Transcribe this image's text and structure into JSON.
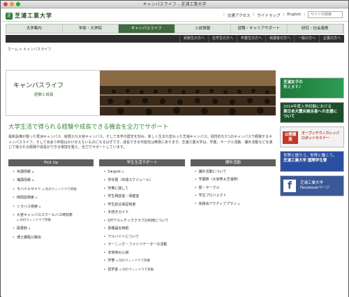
{
  "window": {
    "title": "キャンパスライフ – 芝浦工業大学"
  },
  "header": {
    "logo_mark": "芝",
    "logo_text": "芝浦工業大学",
    "links": [
      "交通アクセス",
      "サイトマップ",
      "English"
    ],
    "search_placeholder": "サイト内検索"
  },
  "mainnav": [
    "大学案内",
    "学部・大学院",
    "キャンパスライフ",
    "入試情報",
    "就職・キャリアサポート",
    "研究・社会連携"
  ],
  "mainnav_active": 2,
  "subnav": [
    "受験生の方へ",
    "在学生の方へ",
    "卒業生の方へ",
    "保護者の方へ",
    "一般の方へ",
    "企業の方へ"
  ],
  "breadcrumb": "ホーム > キャンパスライフ",
  "hero": {
    "title": "キャンパスライフ",
    "subtitle": "経験と成長"
  },
  "headline": "大学生活で得られる経験や成長できる機会を全力でサポート",
  "intro": "最新設備が整った豊洲キャンパス、緑豊かな大宮キャンパス。そして本学の歴史を刻み、新しく生まれ変わった芝浦キャンパス。個性的な3つのキャンパスで経験するキャンパスライフ。そして出会う仲間はかけがえないものになるはずです。成長できる可能性は無限にあります。芝浦工業大学は、学業、サークル活動、課外活動などを通じて得られる経験や成長ができる環境を整え、全力でサポートしています。",
  "columns": [
    {
      "title": "Pick Up",
      "items": [
        {
          "label": "休講情報",
          "badge": "⌂"
        },
        {
          "label": "補講情報",
          "badge": "⌂"
        },
        {
          "label": "モバイルサイト",
          "badge": "⌂ 別のウィンドウで移動"
        },
        {
          "label": "時間割検索",
          "badge": "⌂"
        },
        {
          "label": "シラバス検索",
          "badge": "⌂"
        },
        {
          "label": "大宮キャンパススクールバス時刻表",
          "badge": "⌂ 別のウィンドウで移動"
        },
        {
          "label": "図書館",
          "badge": "⌂"
        },
        {
          "label": "博士課程公聴会",
          "badge": ""
        }
      ]
    },
    {
      "title": "学生生活サポート",
      "items": [
        {
          "label": "S★gsot",
          "badge": "⌂"
        },
        {
          "label": "学年暦（年間スケジュール）",
          "badge": ""
        },
        {
          "label": "学費に関して",
          "badge": ""
        },
        {
          "label": "学生相談室・保健室",
          "badge": ""
        },
        {
          "label": "学生総合保証制度",
          "badge": ""
        },
        {
          "label": "手続きガイド",
          "badge": ""
        },
        {
          "label": "SITアスレチッククラブの利用について",
          "badge": ""
        },
        {
          "label": "各種届出用紙",
          "badge": ""
        },
        {
          "label": "アルバイトについて",
          "badge": ""
        },
        {
          "label": "ラーニング・ファシリテーターの活動",
          "badge": ""
        },
        {
          "label": "非常時の心得",
          "badge": ""
        },
        {
          "label": "学寮",
          "badge": "⌂ 別のウィンドウで移動"
        },
        {
          "label": "奨学金",
          "badge": "⌂ 別のウィンドウで移動"
        }
      ]
    },
    {
      "title": "課外活動",
      "items": [
        {
          "label": "課外活動について",
          "badge": ""
        },
        {
          "label": "学園祭（大宮祭＆芝浦祭）",
          "badge": ""
        },
        {
          "label": "部・サークル",
          "badge": ""
        },
        {
          "label": "学生プロジェクト",
          "badge": ""
        },
        {
          "label": "後援会アクティブプラン",
          "badge": "⌂"
        }
      ]
    }
  ],
  "banners": [
    {
      "line1": "芝浦女子の",
      "line2": "教えます♪"
    },
    {
      "line1": "2014年度入学試験における",
      "line2": "東日本大震災被災者への支援について"
    },
    {
      "line1": "公開講座",
      "line2": "オープンテクノカレッジ ロボットセミナー"
    },
    {
      "line1": "世界と語ろう。世界と働こう。",
      "line2": "芝浦工業大学 国際学生寮"
    },
    {
      "line1": "芝浦工業大学",
      "line2": "Facebookページ"
    }
  ]
}
